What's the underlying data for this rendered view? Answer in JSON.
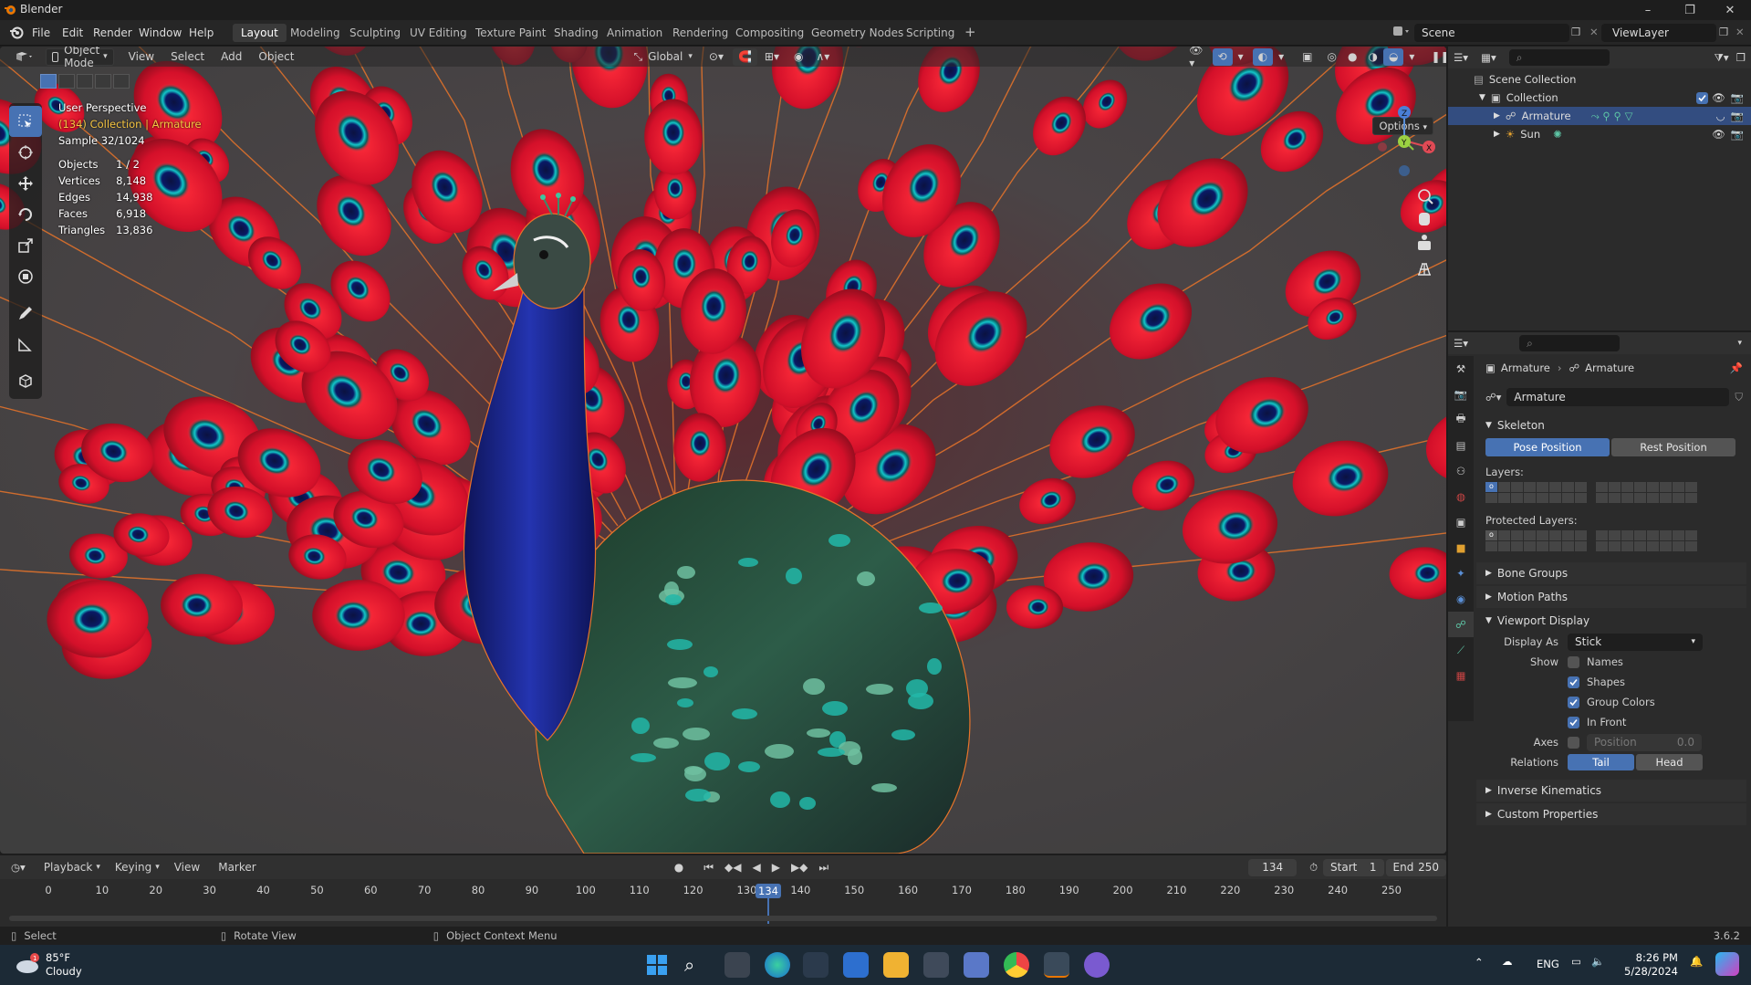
{
  "window": {
    "title": "Blender"
  },
  "menu": [
    "File",
    "Edit",
    "Render",
    "Window",
    "Help"
  ],
  "workspaces": [
    "Layout",
    "Modeling",
    "Sculpting",
    "UV Editing",
    "Texture Paint",
    "Shading",
    "Animation",
    "Rendering",
    "Compositing",
    "Geometry Nodes",
    "Scripting"
  ],
  "active_workspace": "Layout",
  "scene_field": "Scene",
  "viewlayer_field": "ViewLayer",
  "viewport_header": {
    "mode": "Object Mode",
    "menus": [
      "View",
      "Select",
      "Add",
      "Object"
    ],
    "transform": "Global",
    "options": "Options"
  },
  "overlay_info": {
    "perspective": "User Perspective",
    "context": "(134) Collection | Armature",
    "sample": "Sample 32/1024",
    "stats": [
      {
        "label": "Objects",
        "value": "1 / 2"
      },
      {
        "label": "Vertices",
        "value": "8,148"
      },
      {
        "label": "Edges",
        "value": "14,938"
      },
      {
        "label": "Faces",
        "value": "6,918"
      },
      {
        "label": "Triangles",
        "value": "13,836"
      }
    ]
  },
  "outliner": {
    "root": "Scene Collection",
    "collection": "Collection",
    "items": [
      "Armature",
      "Sun"
    ]
  },
  "properties": {
    "breadcrumb_object": "Armature",
    "breadcrumb_data": "Armature",
    "datablock": "Armature",
    "skeleton": {
      "title": "Skeleton",
      "pose_position": "Pose Position",
      "rest_position": "Rest Position",
      "layers_label": "Layers:",
      "protected_label": "Protected Layers:"
    },
    "collapsed_panels": [
      "Bone Groups",
      "Motion Paths"
    ],
    "viewport_display": {
      "title": "Viewport Display",
      "display_as_label": "Display As",
      "display_as_value": "Stick",
      "show_label": "Show",
      "checks": [
        {
          "label": "Names",
          "checked": false
        },
        {
          "label": "Shapes",
          "checked": true
        },
        {
          "label": "Group Colors",
          "checked": true
        },
        {
          "label": "In Front",
          "checked": true
        }
      ],
      "axes_label": "Axes",
      "position_label": "Position",
      "position_value": "0.0",
      "relations_label": "Relations",
      "relations_tail": "Tail",
      "relations_head": "Head"
    },
    "bottom_panels": [
      "Inverse Kinematics",
      "Custom Properties"
    ]
  },
  "timeline": {
    "menus": [
      "Playback",
      "Keying",
      "View",
      "Marker"
    ],
    "current_frame": "134",
    "start_label": "Start",
    "start_value": "1",
    "end_label": "End",
    "end_value": "250",
    "ticks": [
      "0",
      "10",
      "20",
      "30",
      "40",
      "50",
      "60",
      "70",
      "80",
      "90",
      "100",
      "110",
      "120",
      "130",
      "140",
      "150",
      "160",
      "170",
      "180",
      "190",
      "200",
      "210",
      "220",
      "230",
      "240",
      "250"
    ]
  },
  "statusbar": {
    "select": "Select",
    "rotate": "Rotate View",
    "context_menu": "Object Context Menu",
    "version": "3.6.2"
  },
  "taskbar": {
    "weather_temp": "85°F",
    "weather_desc": "Cloudy",
    "lang": "ENG",
    "time": "8:26 PM",
    "date": "5/28/2024"
  },
  "colors": {
    "accent": "#4772b3",
    "selection_outline": "#e8742a",
    "feather_red": "#e0162c",
    "neck_blue": "#1c2a8c"
  }
}
